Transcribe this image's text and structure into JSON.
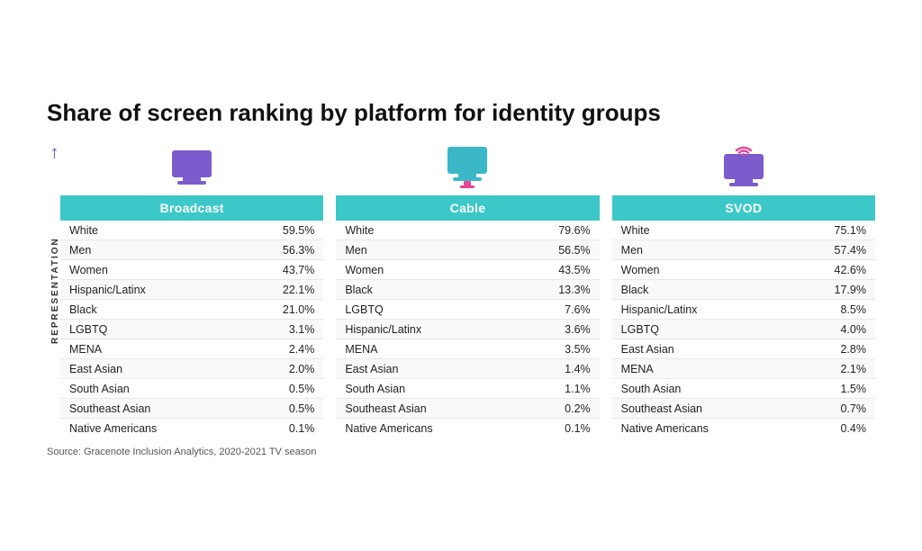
{
  "title": "Share of screen ranking by platform for identity groups",
  "source": "Source: Gracenote Inclusion Analytics, 2020-2021 TV season",
  "side_label": "REPRESENTATION",
  "platforms": [
    {
      "name": "Broadcast",
      "icon": "broadcast",
      "rows": [
        {
          "label": "White",
          "value": "59.5%"
        },
        {
          "label": "Men",
          "value": "56.3%"
        },
        {
          "label": "Women",
          "value": "43.7%"
        },
        {
          "label": "Hispanic/Latinx",
          "value": "22.1%"
        },
        {
          "label": "Black",
          "value": "21.0%"
        },
        {
          "label": "LGBTQ",
          "value": "3.1%"
        },
        {
          "label": "MENA",
          "value": "2.4%"
        },
        {
          "label": "East Asian",
          "value": "2.0%"
        },
        {
          "label": "South Asian",
          "value": "0.5%"
        },
        {
          "label": "Southeast Asian",
          "value": "0.5%"
        },
        {
          "label": "Native Americans",
          "value": "0.1%"
        }
      ]
    },
    {
      "name": "Cable",
      "icon": "cable",
      "rows": [
        {
          "label": "White",
          "value": "79.6%"
        },
        {
          "label": "Men",
          "value": "56.5%"
        },
        {
          "label": "Women",
          "value": "43.5%"
        },
        {
          "label": "Black",
          "value": "13.3%"
        },
        {
          "label": "LGBTQ",
          "value": "7.6%"
        },
        {
          "label": "Hispanic/Latinx",
          "value": "3.6%"
        },
        {
          "label": "MENA",
          "value": "3.5%"
        },
        {
          "label": "East Asian",
          "value": "1.4%"
        },
        {
          "label": "South Asian",
          "value": "1.1%"
        },
        {
          "label": "Southeast Asian",
          "value": "0.2%"
        },
        {
          "label": "Native Americans",
          "value": "0.1%"
        }
      ]
    },
    {
      "name": "SVOD",
      "icon": "svod",
      "rows": [
        {
          "label": "White",
          "value": "75.1%"
        },
        {
          "label": "Men",
          "value": "57.4%"
        },
        {
          "label": "Women",
          "value": "42.6%"
        },
        {
          "label": "Black",
          "value": "17.9%"
        },
        {
          "label": "Hispanic/Latinx",
          "value": "8.5%"
        },
        {
          "label": "LGBTQ",
          "value": "4.0%"
        },
        {
          "label": "East Asian",
          "value": "2.8%"
        },
        {
          "label": "MENA",
          "value": "2.1%"
        },
        {
          "label": "South Asian",
          "value": "1.5%"
        },
        {
          "label": "Southeast Asian",
          "value": "0.7%"
        },
        {
          "label": "Native Americans",
          "value": "0.4%"
        }
      ]
    }
  ]
}
